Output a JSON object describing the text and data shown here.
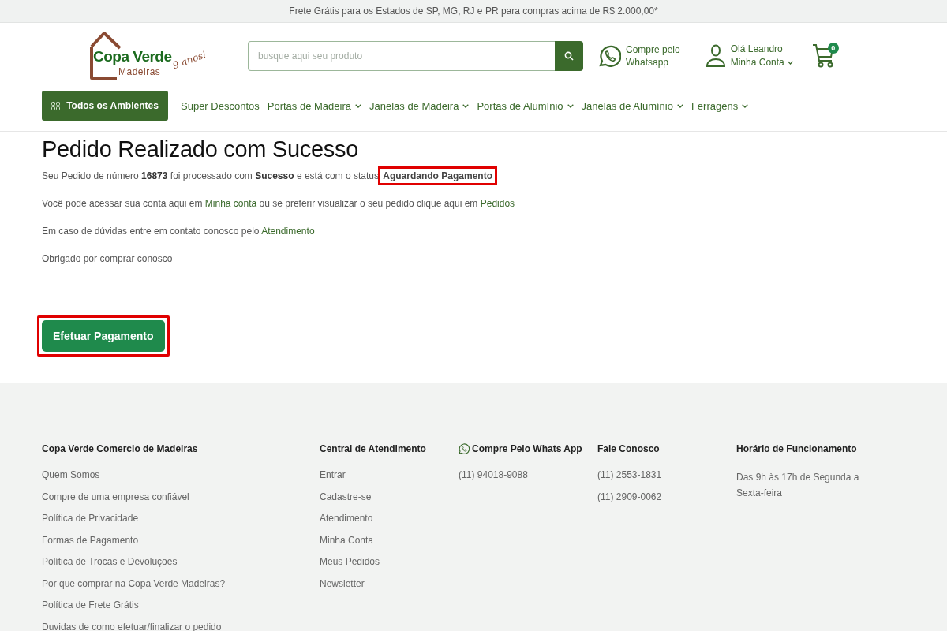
{
  "topbar": {
    "text": "Frete Grátis para os Estados de SP, MG, RJ e PR para compras acima de R$ 2.000,00*"
  },
  "logo": {
    "name": "Copa Verde",
    "subtitle": "Madeiras",
    "tagline": "9 anos!"
  },
  "search": {
    "placeholder": "busque aqui seu produto"
  },
  "whatsapp": {
    "line1": "Compre pelo",
    "line2": "Whatsapp"
  },
  "account": {
    "greeting": "Olá Leandro",
    "label": "Minha Conta"
  },
  "cart": {
    "count": "0"
  },
  "nav": {
    "all_button": "Todos os Ambientes",
    "items": [
      {
        "label": "Super Descontos",
        "has_dropdown": false
      },
      {
        "label": "Portas de Madeira",
        "has_dropdown": true
      },
      {
        "label": "Janelas de Madeira",
        "has_dropdown": true
      },
      {
        "label": "Portas de Alumínio",
        "has_dropdown": true
      },
      {
        "label": "Janelas de Alumínio",
        "has_dropdown": true
      },
      {
        "label": "Ferragens",
        "has_dropdown": true
      }
    ]
  },
  "content": {
    "title": "Pedido Realizado com Sucesso",
    "paragraphs": [
      [
        {
          "kind": "text",
          "text": "Seu Pedido de número **16873** foi processado com **Sucesso** e está com o status"
        },
        {
          "kind": "status",
          "text": "Aguardando Pagamento",
          "highlighted": true
        }
      ],
      [
        {
          "kind": "text",
          "text": "Você pode acessar sua conta aqui em"
        },
        {
          "kind": "link",
          "text": "Minha conta"
        },
        {
          "kind": "text",
          "text": "ou se preferir visualizar o seu pedido clique aqui em"
        },
        {
          "kind": "link",
          "text": "Pedidos"
        }
      ],
      [
        {
          "kind": "text",
          "text": "Em caso de dúvidas entre em contato conosco pelo"
        },
        {
          "kind": "link",
          "text": "Atendimento"
        }
      ],
      [
        {
          "kind": "text",
          "text": "Obrigado por comprar conosco"
        }
      ]
    ],
    "pay_button": {
      "label": "Efetuar Pagamento",
      "highlighted": true
    }
  },
  "footer": {
    "columns": [
      {
        "title": "Copa Verde Comercio de Madeiras",
        "kind": "plain",
        "links": [
          "Quem Somos",
          "Compre de uma empresa confiável",
          "Política de Privacidade",
          "Formas de Pagamento",
          "Política de Trocas e Devoluções",
          "Por que comprar na Copa Verde Madeiras?",
          "Política de Frete Grátis",
          "Duvidas de como efetuar/finalizar o pedido"
        ]
      },
      {
        "title": "Central de Atendimento",
        "kind": "plain",
        "links": [
          "Entrar",
          "Cadastre-se",
          "Atendimento",
          "Minha Conta",
          "Meus Pedidos",
          "Newsletter"
        ]
      },
      {
        "title": "Compre Pelo Whats App",
        "kind": "whatsapp",
        "links": [
          "(11) 94018-9088"
        ]
      },
      {
        "title": "Fale Conosco",
        "kind": "plain",
        "links": [
          "(11) 2553-1831",
          "(11) 2909-0062"
        ]
      },
      {
        "title": "Horário de Funcionamento",
        "kind": "plain",
        "text": "Das 9h às 17h de Segunda a Sexta-feira"
      }
    ]
  }
}
